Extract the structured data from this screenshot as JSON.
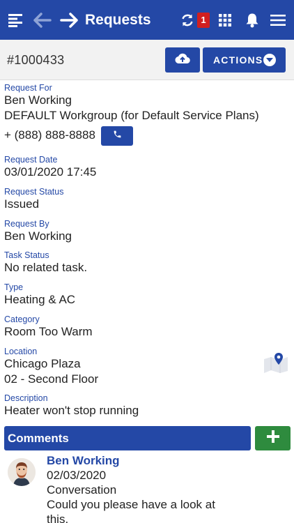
{
  "header": {
    "title": "Requests",
    "sync_badge": "1",
    "icons": [
      "menu-list-icon",
      "back-arrow-icon",
      "forward-arrow-icon",
      "sync-icon",
      "apps-grid-icon",
      "bell-icon",
      "hamburger-menu-icon"
    ]
  },
  "toolbar": {
    "request_id": "#1000433",
    "actions_label": "ACTIONS",
    "upload_icon": "cloud-upload-icon"
  },
  "details": {
    "request_for_label": "Request For",
    "request_for_name": "Ben Working",
    "request_for_workgroup": "DEFAULT Workgroup (for Default Service Plans)",
    "request_for_phone": "+ (888) 888-8888",
    "request_date_label": "Request Date",
    "request_date": "03/01/2020 17:45",
    "request_status_label": "Request Status",
    "request_status": "Issued",
    "request_by_label": "Request By",
    "request_by": "Ben Working",
    "task_status_label": "Task Status",
    "task_status": "No related task.",
    "type_label": "Type",
    "type": "Heating & AC",
    "category_label": "Category",
    "category": "Room Too Warm",
    "location_label": "Location",
    "location_line1": "Chicago Plaza",
    "location_line2": "02 - Second Floor",
    "description_label": "Description",
    "description": "Heater won't stop running"
  },
  "comments": {
    "title": "Comments",
    "items": [
      {
        "author": "Ben Working",
        "date": "02/03/2020",
        "kind": "Conversation",
        "text_line1": "Could you please have a look at",
        "text_line2": "this."
      }
    ]
  },
  "colors": {
    "primary": "#2448a6",
    "badge": "#d11f1f",
    "add_button": "#2e8b3e"
  }
}
